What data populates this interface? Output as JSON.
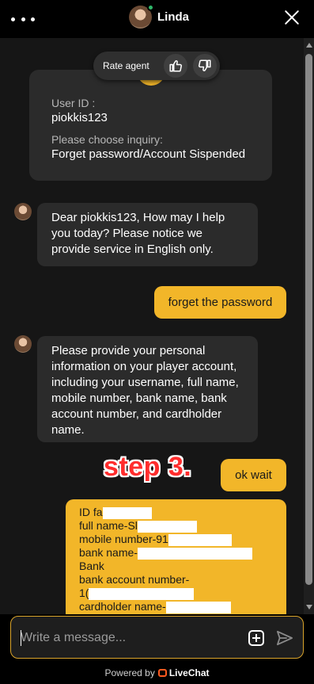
{
  "header": {
    "agent_name": "Linda",
    "menu_icon": "more-horizontal-icon",
    "close_icon": "close-icon"
  },
  "rating": {
    "label": "Rate agent",
    "thumbs_up_icon": "thumbs-up-icon",
    "thumbs_down_icon": "thumbs-down-icon"
  },
  "form": {
    "user_id_label": "User ID :",
    "user_id_value": "piokkis123",
    "inquiry_label": "Please choose inquiry:",
    "inquiry_value": "Forget password/Account Sispended"
  },
  "messages": [
    {
      "from": "agent",
      "text": "Dear piokkis123, How may I help you today? Please notice we provide service in English only."
    },
    {
      "from": "user",
      "text": "forget the password"
    },
    {
      "from": "agent",
      "text": "Please provide your personal information on your player account, including your username, full name, mobile number, bank name, bank account number, and cardholder name."
    },
    {
      "from": "user",
      "text": "ok wait"
    }
  ],
  "annotation": {
    "text": "step 3."
  },
  "info_message": {
    "line1": "ID fa",
    "line2": "full name-Sl",
    "line3": "mobile number-91",
    "line4": "bank name-",
    "line5": "Bank",
    "line6": "bank account number-",
    "line7": "1(",
    "line8": "cardholder name-"
  },
  "composer": {
    "placeholder": "Write a message...",
    "attach_icon": "add-attachment-icon",
    "send_icon": "send-icon"
  },
  "footer": {
    "powered_by": "Powered by",
    "brand": "LiveChat"
  },
  "colors": {
    "accent": "#f2b629",
    "background": "#161616",
    "bubble_agent": "#2b2b2b",
    "annotation": "#ff2d2d"
  }
}
